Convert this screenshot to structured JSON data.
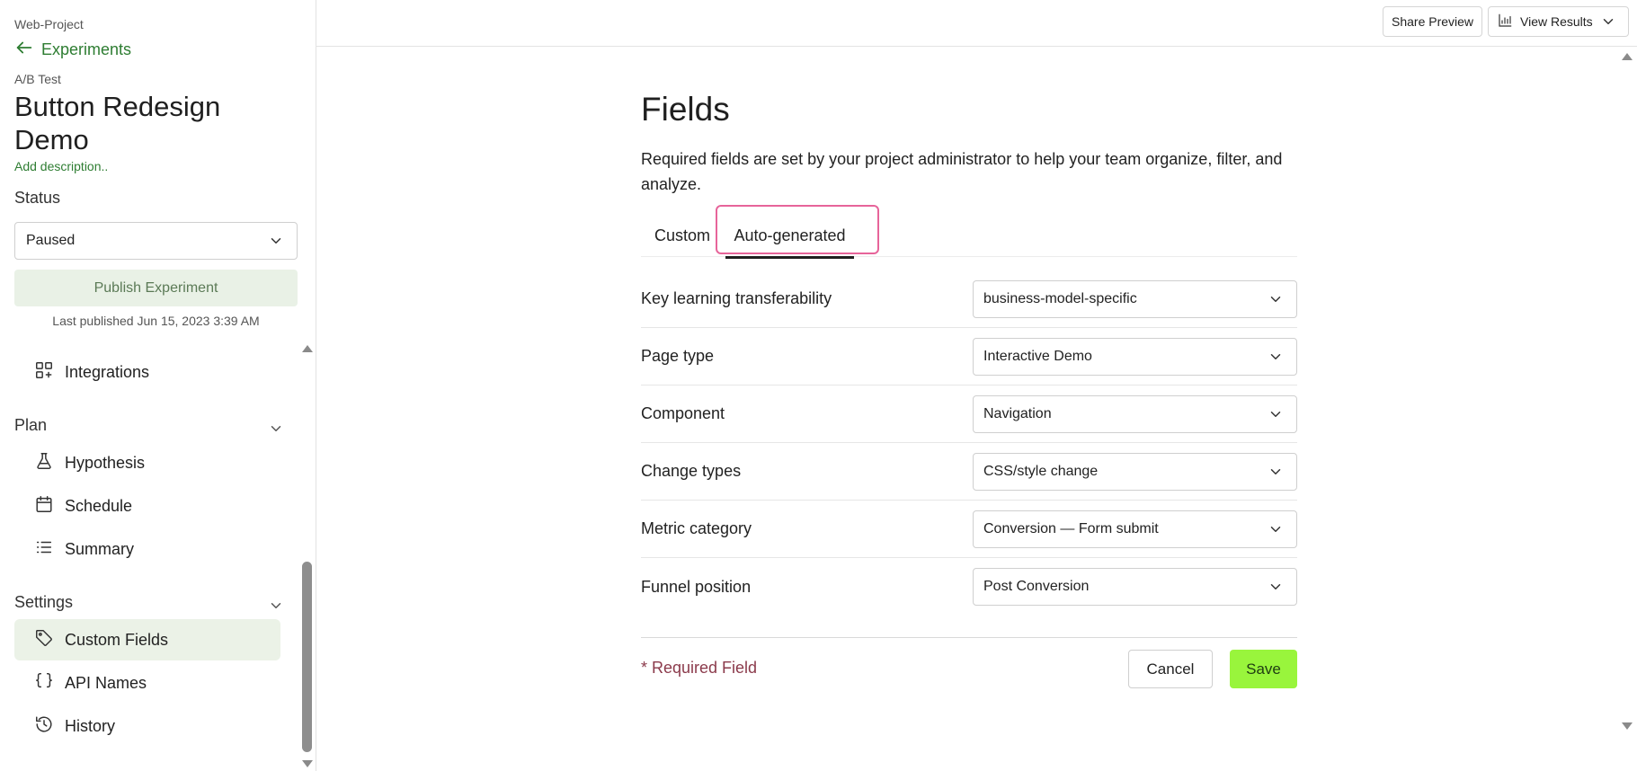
{
  "sidebar": {
    "project": "Web-Project",
    "back_label": "Experiments",
    "experiment_type": "A/B Test",
    "experiment_title": "Button Redesign Demo",
    "add_description": "Add description..",
    "status_label": "Status",
    "status_value": "Paused",
    "publish_label": "Publish Experiment",
    "last_published": "Last published Jun 15, 2023 3:39 AM",
    "nav": {
      "integrations": "Integrations",
      "plan_heading": "Plan",
      "hypothesis": "Hypothesis",
      "schedule": "Schedule",
      "summary": "Summary",
      "settings_heading": "Settings",
      "custom_fields": "Custom Fields",
      "api_names": "API Names",
      "history": "History"
    }
  },
  "topbar": {
    "share_preview": "Share Preview",
    "view_results": "View Results"
  },
  "main": {
    "title": "Fields",
    "description": "Required fields are set by your project administrator to help your team organize, filter, and analyze.",
    "tabs": [
      {
        "label": "Custom",
        "active": false
      },
      {
        "label": "Auto-generated",
        "active": true
      }
    ],
    "fields": [
      {
        "label": "Key learning transferability",
        "value": "business-model-specific"
      },
      {
        "label": "Page type",
        "value": "Interactive Demo"
      },
      {
        "label": "Component",
        "value": "Navigation"
      },
      {
        "label": "Change types",
        "value": "CSS/style change"
      },
      {
        "label": "Metric category",
        "value": "Conversion — Form submit"
      },
      {
        "label": "Funnel position",
        "value": "Post Conversion"
      }
    ],
    "required_note": "* Required Field",
    "cancel_label": "Cancel",
    "save_label": "Save"
  },
  "colors": {
    "accent_green": "#2e7d32",
    "save_button": "#99f53c",
    "active_nav_bg": "#ebf2e7",
    "tab_highlight": "#e7649a",
    "required_text": "#8b3a4b"
  }
}
